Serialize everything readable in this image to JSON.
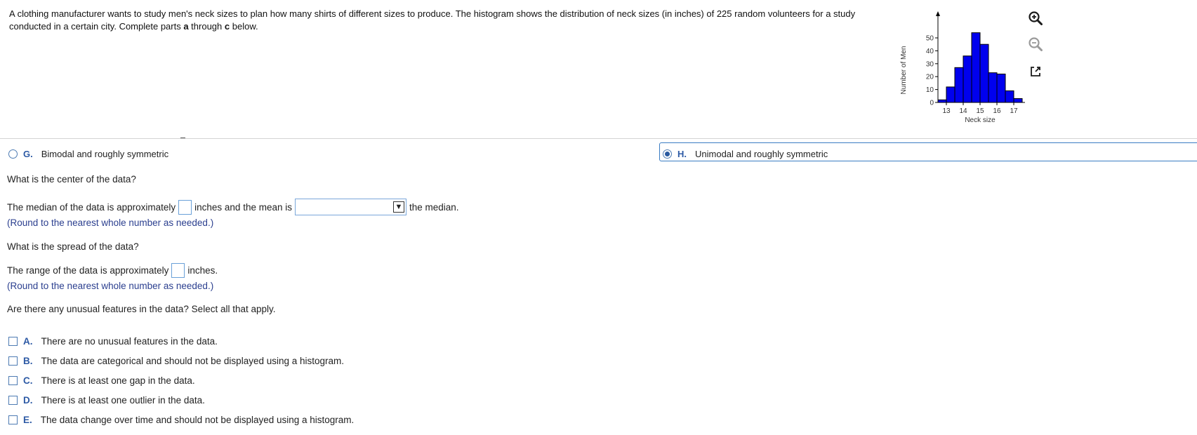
{
  "prompt": {
    "part1": "A clothing manufacturer wants to study men's neck sizes to plan how many shirts of different sizes to produce. The histogram shows the distribution of neck sizes (in inches) of 225 random volunteers for a study conducted in a certain city. Complete parts ",
    "bold_a": "a",
    "part2": " through ",
    "bold_c": "c",
    "part3": " below."
  },
  "tools": {
    "zoom_in": "zoom-in-icon",
    "zoom_out": "zoom-out-icon",
    "popout": "popout-icon"
  },
  "chart_data": {
    "type": "bar",
    "categories": [
      "12.75",
      "13.25",
      "13.75",
      "14.25",
      "14.75",
      "15.25",
      "15.75",
      "16.25",
      "16.75",
      "17.25"
    ],
    "values": [
      2,
      12,
      27,
      36,
      54,
      45,
      23,
      22,
      9,
      3
    ],
    "bin_start": 12.5,
    "bin_width": 0.5,
    "xlabel": "Neck size",
    "ylabel": "Number of Men",
    "xticks": [
      "13",
      "14",
      "15",
      "16",
      "17"
    ],
    "yticks": [
      "0",
      "10",
      "20",
      "30",
      "40",
      "50"
    ],
    "ylim": [
      0,
      60
    ],
    "xlim": [
      12.5,
      18
    ],
    "bar_color": "#0000ee"
  },
  "options_shape": [
    {
      "letter": "G.",
      "text": "Bimodal and roughly symmetric",
      "selected": false
    },
    {
      "letter": "H.",
      "text": "Unimodal and roughly symmetric",
      "selected": true
    }
  ],
  "center": {
    "question": "What is the center of the data?",
    "s1": "The median of the data is approximately",
    "s2": "inches and the mean is",
    "s3": "the median.",
    "dropdown_value": "",
    "dropdown_arrow": "▼",
    "hint": "(Round to the nearest whole number as needed.)"
  },
  "spread": {
    "question": "What is the spread of the data?",
    "s1": "The range of the data is approximately",
    "s2": "inches.",
    "hint": "(Round to the nearest whole number as needed.)"
  },
  "unusual": {
    "question": "Are there any unusual features in the data? Select all that apply.",
    "options": [
      {
        "letter": "A.",
        "text": "There are no unusual features in the data."
      },
      {
        "letter": "B.",
        "text": "The data are categorical and should not be displayed using a histogram."
      },
      {
        "letter": "C.",
        "text": "There is at least one gap in the data."
      },
      {
        "letter": "D.",
        "text": "There is at least one outlier in the data."
      },
      {
        "letter": "E.",
        "text": "The data change over time and should not be displayed using a histogram."
      }
    ]
  }
}
